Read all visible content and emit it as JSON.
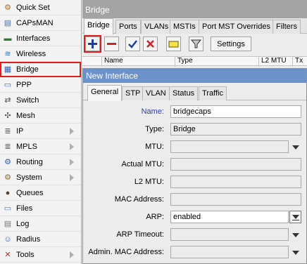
{
  "sidebar": {
    "items": [
      {
        "label": "Quick Set",
        "icon": "quick-set-icon",
        "glyph": "⚙",
        "color": "#c36b1d"
      },
      {
        "label": "CAPsMAN",
        "icon": "capsman-icon",
        "glyph": "▤",
        "color": "#4b6fa8"
      },
      {
        "label": "Interfaces",
        "icon": "interfaces-icon",
        "glyph": "▬",
        "color": "#2e7d32"
      },
      {
        "label": "Wireless",
        "icon": "wireless-icon",
        "glyph": "≋",
        "color": "#3f6fb5"
      },
      {
        "label": "Bridge",
        "icon": "bridge-icon",
        "glyph": "▦",
        "color": "#2e64b5"
      },
      {
        "label": "PPP",
        "icon": "ppp-icon",
        "glyph": "▭",
        "color": "#3a6fb0"
      },
      {
        "label": "Switch",
        "icon": "switch-icon",
        "glyph": "⇄",
        "color": "#555555"
      },
      {
        "label": "Mesh",
        "icon": "mesh-icon",
        "glyph": "✣",
        "color": "#555555"
      },
      {
        "label": "IP",
        "icon": "ip-icon",
        "glyph": "≣",
        "color": "#666666"
      },
      {
        "label": "MPLS",
        "icon": "mpls-icon",
        "glyph": "≣",
        "color": "#666666"
      },
      {
        "label": "Routing",
        "icon": "routing-icon",
        "glyph": "⚙",
        "color": "#2e64b5"
      },
      {
        "label": "System",
        "icon": "system-icon",
        "glyph": "⚙",
        "color": "#8a6a2f"
      },
      {
        "label": "Queues",
        "icon": "queues-icon",
        "glyph": "●",
        "color": "#5a3e2b"
      },
      {
        "label": "Files",
        "icon": "files-icon",
        "glyph": "▭",
        "color": "#4f7fbf"
      },
      {
        "label": "Log",
        "icon": "log-icon",
        "glyph": "▤",
        "color": "#777777"
      },
      {
        "label": "Radius",
        "icon": "radius-icon",
        "glyph": "☺",
        "color": "#2e64b5"
      },
      {
        "label": "Tools",
        "icon": "tools-icon",
        "glyph": "✕",
        "color": "#c62828"
      }
    ],
    "submenu_items": [
      "IP",
      "MPLS",
      "Routing",
      "System",
      "Tools"
    ],
    "selected": "Bridge"
  },
  "bridge_window": {
    "title": "Bridge",
    "tabs": [
      "Bridge",
      "Ports",
      "VLANs",
      "MSTIs",
      "Port MST Overrides",
      "Filters"
    ],
    "active_tab": "Bridge",
    "toolbar": {
      "settings_label": "Settings"
    },
    "columns": [
      "Name",
      "Type",
      "L2 MTU",
      "Tx"
    ]
  },
  "dialog": {
    "title": "New Interface",
    "tabs": [
      "General",
      "STP",
      "VLAN",
      "Status",
      "Traffic"
    ],
    "active_tab": "General",
    "fields": {
      "name": {
        "label": "Name:",
        "value": "bridgecaps"
      },
      "type": {
        "label": "Type:",
        "value": "Bridge"
      },
      "mtu": {
        "label": "MTU:",
        "value": ""
      },
      "actual_mtu": {
        "label": "Actual MTU:",
        "value": ""
      },
      "l2_mtu": {
        "label": "L2 MTU:",
        "value": ""
      },
      "mac_address": {
        "label": "MAC Address:",
        "value": ""
      },
      "arp": {
        "label": "ARP:",
        "value": "enabled"
      },
      "arp_timeout": {
        "label": "ARP Timeout:",
        "value": ""
      },
      "admin_mac": {
        "label": "Admin. MAC Address:",
        "value": ""
      }
    }
  },
  "colors": {
    "title_bar": "#a3a3a3",
    "dialog_title": "#6b92c9",
    "highlight": "#e01e1e",
    "label_blue": "#2d3ba8"
  }
}
